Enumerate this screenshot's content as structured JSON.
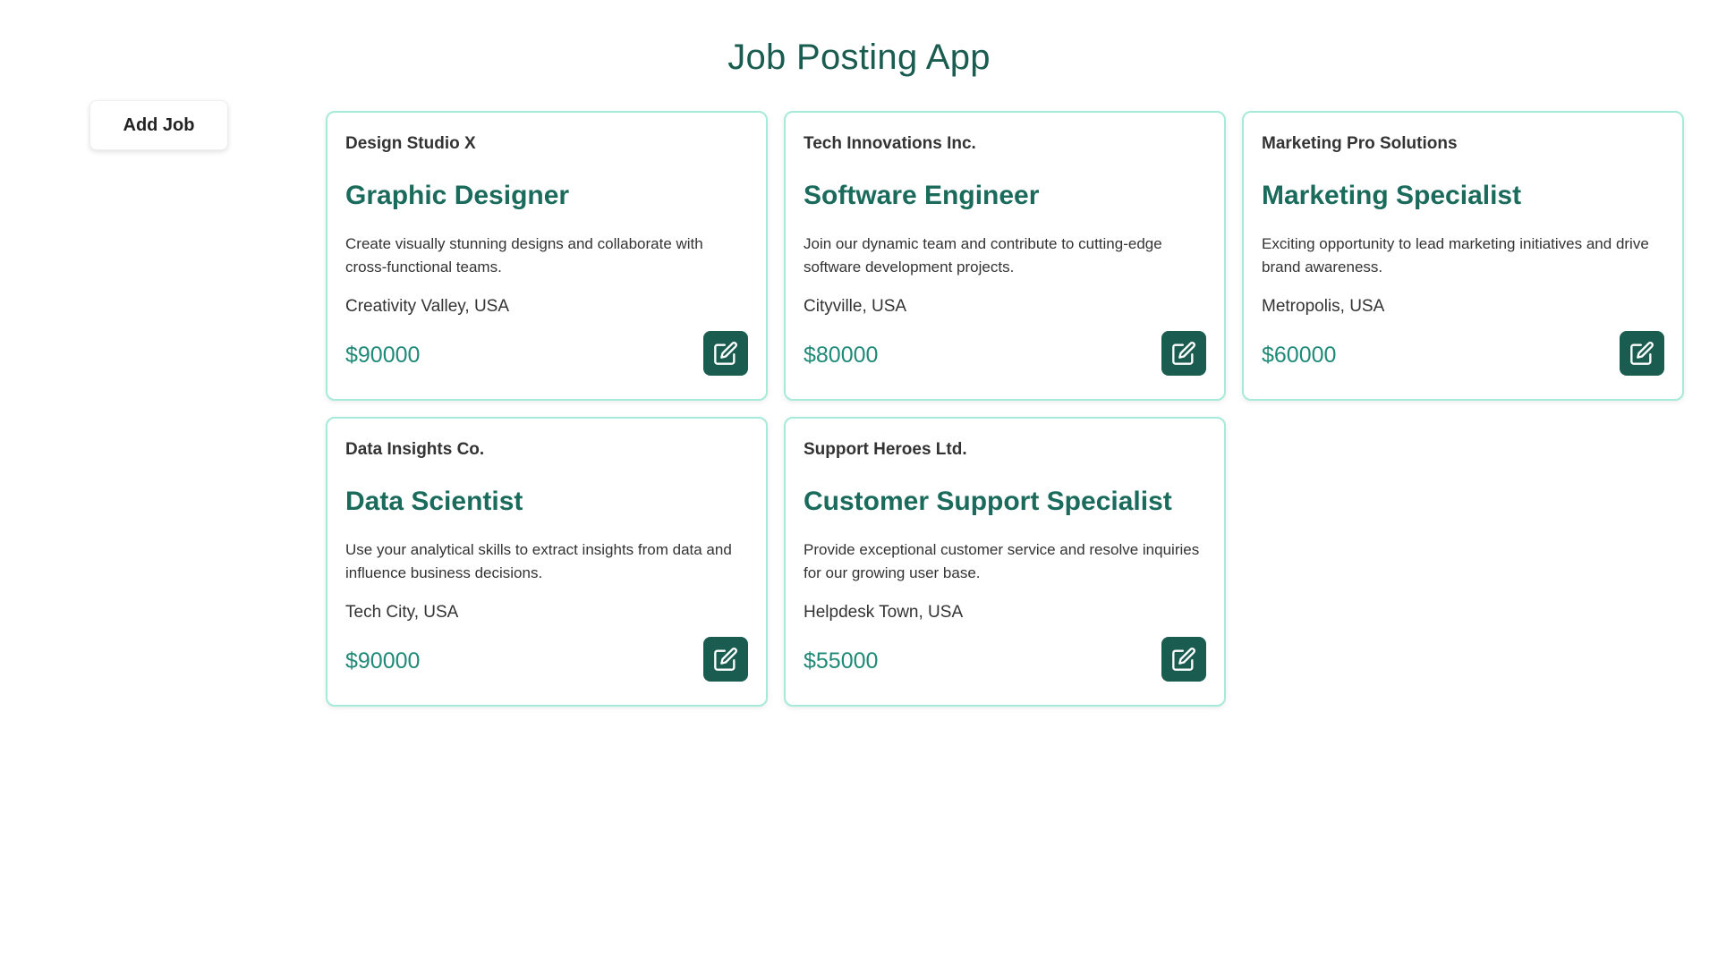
{
  "app": {
    "title": "Job Posting App"
  },
  "toolbar": {
    "add_job_label": "Add Job"
  },
  "colors": {
    "accent": "#1a5c50",
    "title_text": "#1b6b5c",
    "salary_text": "#1f8a78",
    "card_border": "#a6ead9"
  },
  "jobs": [
    {
      "company": "Design Studio X",
      "title": "Graphic Designer",
      "description": "Create visually stunning designs and collaborate with cross-functional teams.",
      "location": "Creativity Valley, USA",
      "salary": "$90000",
      "edit_icon": "edit-icon"
    },
    {
      "company": "Tech Innovations Inc.",
      "title": "Software Engineer",
      "description": "Join our dynamic team and contribute to cutting-edge software development projects.",
      "location": "Cityville, USA",
      "salary": "$80000",
      "edit_icon": "edit-icon"
    },
    {
      "company": "Marketing Pro Solutions",
      "title": "Marketing Specialist",
      "description": "Exciting opportunity to lead marketing initiatives and drive brand awareness.",
      "location": "Metropolis, USA",
      "salary": "$60000",
      "edit_icon": "edit-icon"
    },
    {
      "company": "Data Insights Co.",
      "title": "Data Scientist",
      "description": "Use your analytical skills to extract insights from data and influence business decisions.",
      "location": "Tech City, USA",
      "salary": "$90000",
      "edit_icon": "edit-icon"
    },
    {
      "company": "Support Heroes Ltd.",
      "title": "Customer Support Specialist",
      "description": "Provide exceptional customer service and resolve inquiries for our growing user base.",
      "location": "Helpdesk Town, USA",
      "salary": "$55000",
      "edit_icon": "edit-icon"
    }
  ]
}
